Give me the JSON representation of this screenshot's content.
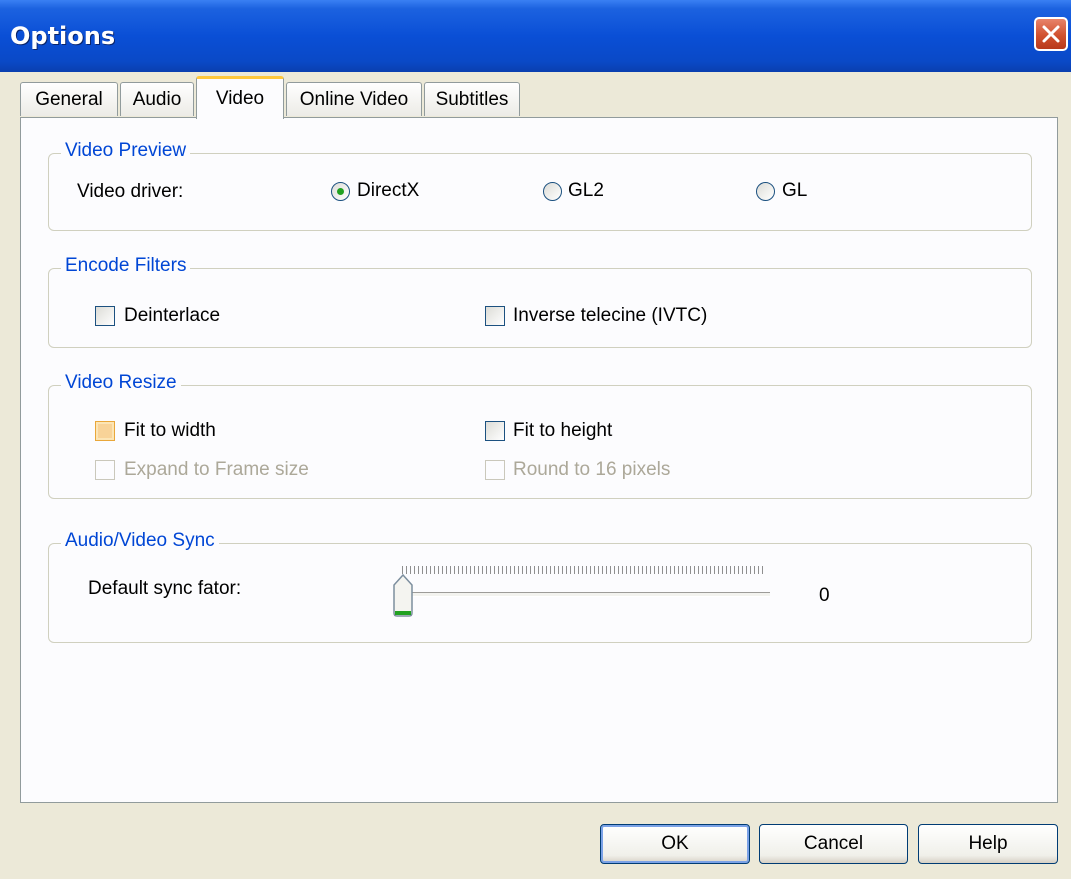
{
  "window": {
    "title": "Options"
  },
  "tabs": [
    {
      "label": "General",
      "active": false
    },
    {
      "label": "Audio",
      "active": false
    },
    {
      "label": "Video",
      "active": true
    },
    {
      "label": "Online Video",
      "active": false
    },
    {
      "label": "Subtitles",
      "active": false
    }
  ],
  "video_preview": {
    "legend": "Video Preview",
    "driver_label": "Video driver:",
    "options": [
      {
        "label": "DirectX",
        "checked": true
      },
      {
        "label": "GL2",
        "checked": false
      },
      {
        "label": "GL",
        "checked": false
      }
    ]
  },
  "encode_filters": {
    "legend": "Encode Filters",
    "deinterlace": "Deinterlace",
    "ivtc": "Inverse telecine (IVTC)"
  },
  "video_resize": {
    "legend": "Video Resize",
    "fit_width": "Fit to width",
    "fit_height": "Fit to height",
    "expand_frame": "Expand to Frame size",
    "round16": "Round to 16 pixels"
  },
  "av_sync": {
    "legend": "Audio/Video Sync",
    "label": "Default sync fator:",
    "value": "0"
  },
  "buttons": {
    "ok": "OK",
    "cancel": "Cancel",
    "help": "Help"
  },
  "colors": {
    "titlebar": "#0A4FD6",
    "legend": "#0046D5",
    "face": "#ECE9D8",
    "tab_highlight": "#FFC83C"
  }
}
